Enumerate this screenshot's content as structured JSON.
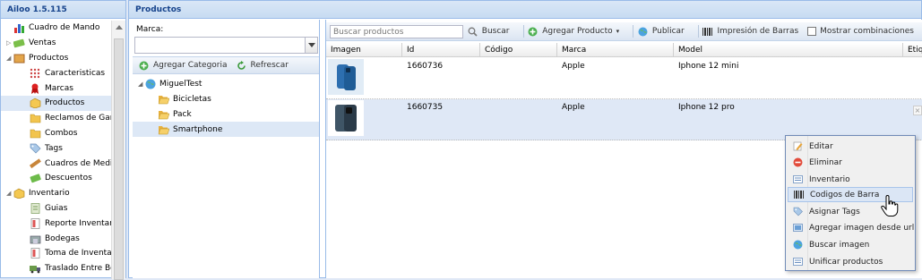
{
  "left_panel": {
    "title": "Ailoo 1.5.115",
    "items": [
      {
        "label": "Cuadro de Mando",
        "icon": "chart-icon",
        "level": 1,
        "expander": ""
      },
      {
        "label": "Ventas",
        "icon": "cash-icon",
        "level": 1,
        "expander": "▷"
      },
      {
        "label": "Productos",
        "icon": "box-icon",
        "level": 1,
        "expander": "◢"
      },
      {
        "label": "Caracteristicas",
        "icon": "grid-dots-icon",
        "level": 2
      },
      {
        "label": "Marcas",
        "icon": "ribbon-icon",
        "level": 2
      },
      {
        "label": "Productos",
        "icon": "product-box-icon",
        "level": 2,
        "selected": true
      },
      {
        "label": "Reclamos de Gara",
        "icon": "folder-icon",
        "level": 2
      },
      {
        "label": "Combos",
        "icon": "folder-icon",
        "level": 2
      },
      {
        "label": "Tags",
        "icon": "tag-icon",
        "level": 2
      },
      {
        "label": "Cuadros de Medida",
        "icon": "ruler-icon",
        "level": 2
      },
      {
        "label": "Descuentos",
        "icon": "discount-icon",
        "level": 2
      },
      {
        "label": "Inventario",
        "icon": "box-icon",
        "level": 1,
        "expander": "◢"
      },
      {
        "label": "Guias",
        "icon": "doc-icon",
        "level": 2
      },
      {
        "label": "Reporte Inventario",
        "icon": "report-icon",
        "level": 2
      },
      {
        "label": "Bodegas",
        "icon": "warehouse-icon",
        "level": 2
      },
      {
        "label": "Toma de Inventario",
        "icon": "report-icon",
        "level": 2
      },
      {
        "label": "Traslado Entre Bod",
        "icon": "truck-icon",
        "level": 2
      }
    ]
  },
  "main_panel": {
    "title": "Productos"
  },
  "category_panel": {
    "brand_label": "Marca:",
    "brand_value": "",
    "toolbar": {
      "add_category": "Agregar Categoria",
      "refresh": "Refrescar"
    },
    "tree": [
      {
        "label": "MiguelTest",
        "icon": "globe-icon",
        "level": 0,
        "expander": "◢"
      },
      {
        "label": "Bicicletas",
        "icon": "folder-open-icon",
        "level": 1
      },
      {
        "label": "Pack",
        "icon": "folder-open-icon",
        "level": 1
      },
      {
        "label": "Smartphone",
        "icon": "folder-open-icon",
        "level": 1,
        "selected": true
      }
    ]
  },
  "grid_toolbar": {
    "search_placeholder": "Buscar productos",
    "search_button": "Buscar",
    "add_product": "Agregar Producto",
    "publish": "Publicar",
    "print_barcodes": "Impresión de Barras",
    "show_combinations": "Mostrar combinaciones"
  },
  "grid": {
    "columns": [
      "Imagen",
      "Id",
      "Código",
      "Marca",
      "Model",
      "Etiq"
    ],
    "rows": [
      {
        "id": "1660736",
        "code": "",
        "brand": "Apple",
        "model": "Iphone 12 mini"
      },
      {
        "id": "1660735",
        "code": "",
        "brand": "Apple",
        "model": "Iphone 12 pro"
      }
    ]
  },
  "context_menu": {
    "items": [
      {
        "label": "Editar",
        "icon": "edit-icon"
      },
      {
        "label": "Eliminar",
        "icon": "delete-icon"
      },
      {
        "label": "Inventario",
        "icon": "inventory-icon"
      },
      {
        "label": "Codigos de Barra",
        "icon": "barcode-icon",
        "active": true
      },
      {
        "label": "Asignar Tags",
        "icon": "tag-icon"
      },
      {
        "label": "Agregar imagen desde url",
        "icon": "image-url-icon"
      },
      {
        "label": "Buscar imagen",
        "icon": "globe-icon"
      },
      {
        "label": "Unificar productos",
        "icon": "merge-icon"
      }
    ]
  },
  "colors": {
    "header_text": "#15428b",
    "panel_border": "#99bbe8",
    "selected_row": "#dfe8f6"
  }
}
